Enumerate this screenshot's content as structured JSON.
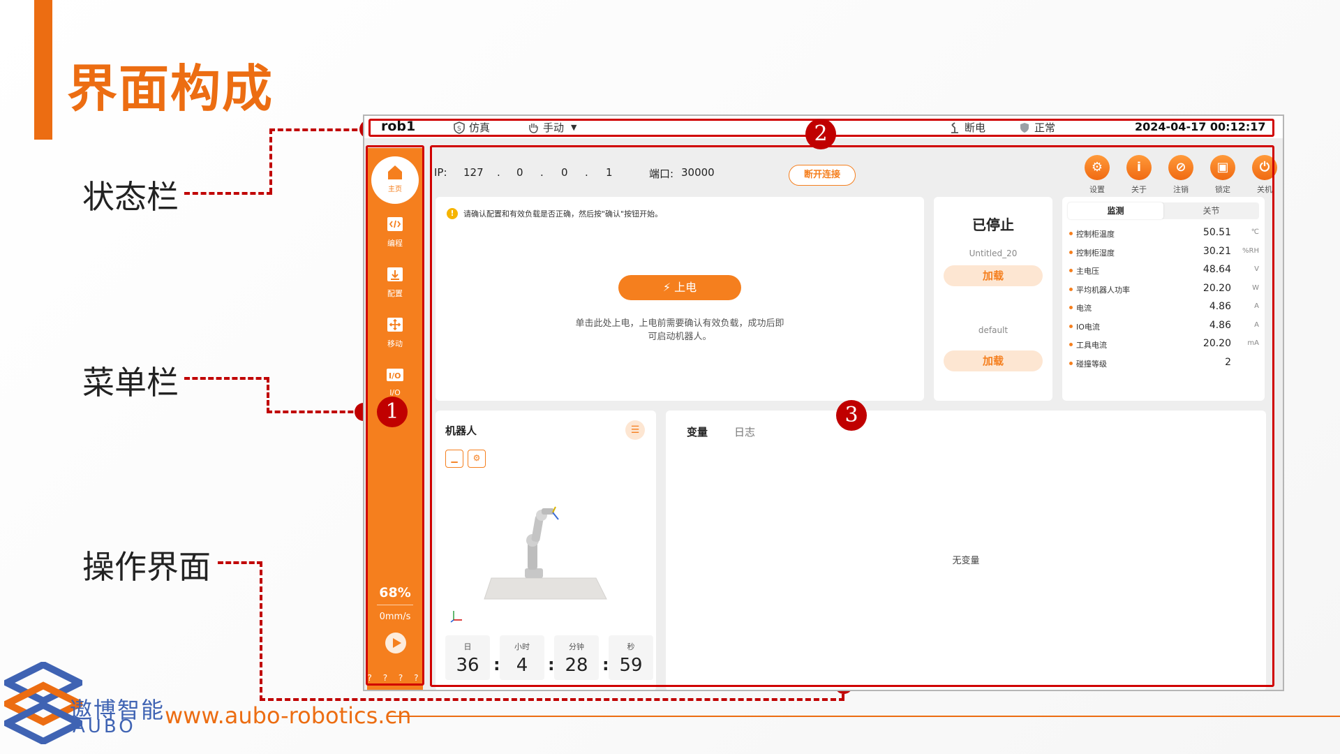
{
  "slide": {
    "title": "界面构成",
    "callouts": {
      "status_bar": "状态栏",
      "menu_bar": "菜单栏",
      "operation_ui": "操作界面"
    },
    "markers": [
      "1",
      "2",
      "3"
    ],
    "brand": {
      "name_cn": "遨博智能",
      "name_en": "AUBO",
      "url": "www.aubo-robotics.cn"
    },
    "colors": {
      "accent": "#ec6d12",
      "annotation": "#c00000",
      "brand_blue": "#3f63b3"
    }
  },
  "app": {
    "status_bar": {
      "robot_name": "rob1",
      "simulation_label": "仿真",
      "mode_label": "手动",
      "power_label": "断电",
      "state_label": "正常",
      "datetime": "2024-04-17 00:12:17"
    },
    "sidebar": {
      "items": [
        {
          "label": "主页",
          "icon": "home-icon"
        },
        {
          "label": "编程",
          "icon": "code-icon"
        },
        {
          "label": "配置",
          "icon": "download-config-icon"
        },
        {
          "label": "移动",
          "icon": "move-icon"
        },
        {
          "label": "I/O",
          "icon": "io-icon"
        }
      ],
      "speed_percent": "68%",
      "speed_rate": "0mm/s",
      "dots": "? ? ? ?"
    },
    "connection": {
      "ip_label": "IP:",
      "ip_parts": [
        "127",
        ".",
        "0",
        ".",
        "0",
        ".",
        "1"
      ],
      "port_label": "端口:",
      "port_value": "30000",
      "disconnect_label": "断开连接"
    },
    "toolbar": {
      "items": [
        {
          "label": "设置",
          "icon": "gear-icon"
        },
        {
          "label": "关于",
          "icon": "info-icon"
        },
        {
          "label": "注销",
          "icon": "logout-icon"
        },
        {
          "label": "锁定",
          "icon": "lock-icon"
        },
        {
          "label": "关机",
          "icon": "power-icon"
        }
      ]
    },
    "power_panel": {
      "warning": "请确认配置和有效负载是否正确，然后按\"确认\"按钮开始。",
      "power_on_label": "上电",
      "hint": "单击此处上电，上电前需要确认有效负载，成功后即可启动机器人。"
    },
    "project_panel": {
      "state": "已停止",
      "project_name": "Untitled_20",
      "load_label_1": "加载",
      "default_name": "default",
      "load_label_2": "加载"
    },
    "monitor_panel": {
      "tabs": [
        "监测",
        "关节"
      ],
      "rows": [
        {
          "name": "控制柜温度",
          "value": "50.51",
          "unit": "℃"
        },
        {
          "name": "控制柜湿度",
          "value": "30.21",
          "unit": "%RH"
        },
        {
          "name": "主电压",
          "value": "48.64",
          "unit": "V"
        },
        {
          "name": "平均机器人功率",
          "value": "20.20",
          "unit": "W"
        },
        {
          "name": "电流",
          "value": "4.86",
          "unit": "A"
        },
        {
          "name": "IO电流",
          "value": "4.86",
          "unit": "A"
        },
        {
          "name": "工具电流",
          "value": "20.20",
          "unit": "mA"
        },
        {
          "name": "碰撞等级",
          "value": "2",
          "unit": ""
        }
      ]
    },
    "robot_panel": {
      "title": "机器人",
      "time_labels": [
        "日",
        "小时",
        "分钟",
        "秒"
      ],
      "time_values": [
        "36",
        "4",
        "28",
        "59"
      ],
      "separator": ":"
    },
    "vars_panel": {
      "tabs": [
        "变量",
        "日志"
      ],
      "empty_text": "无变量"
    }
  }
}
